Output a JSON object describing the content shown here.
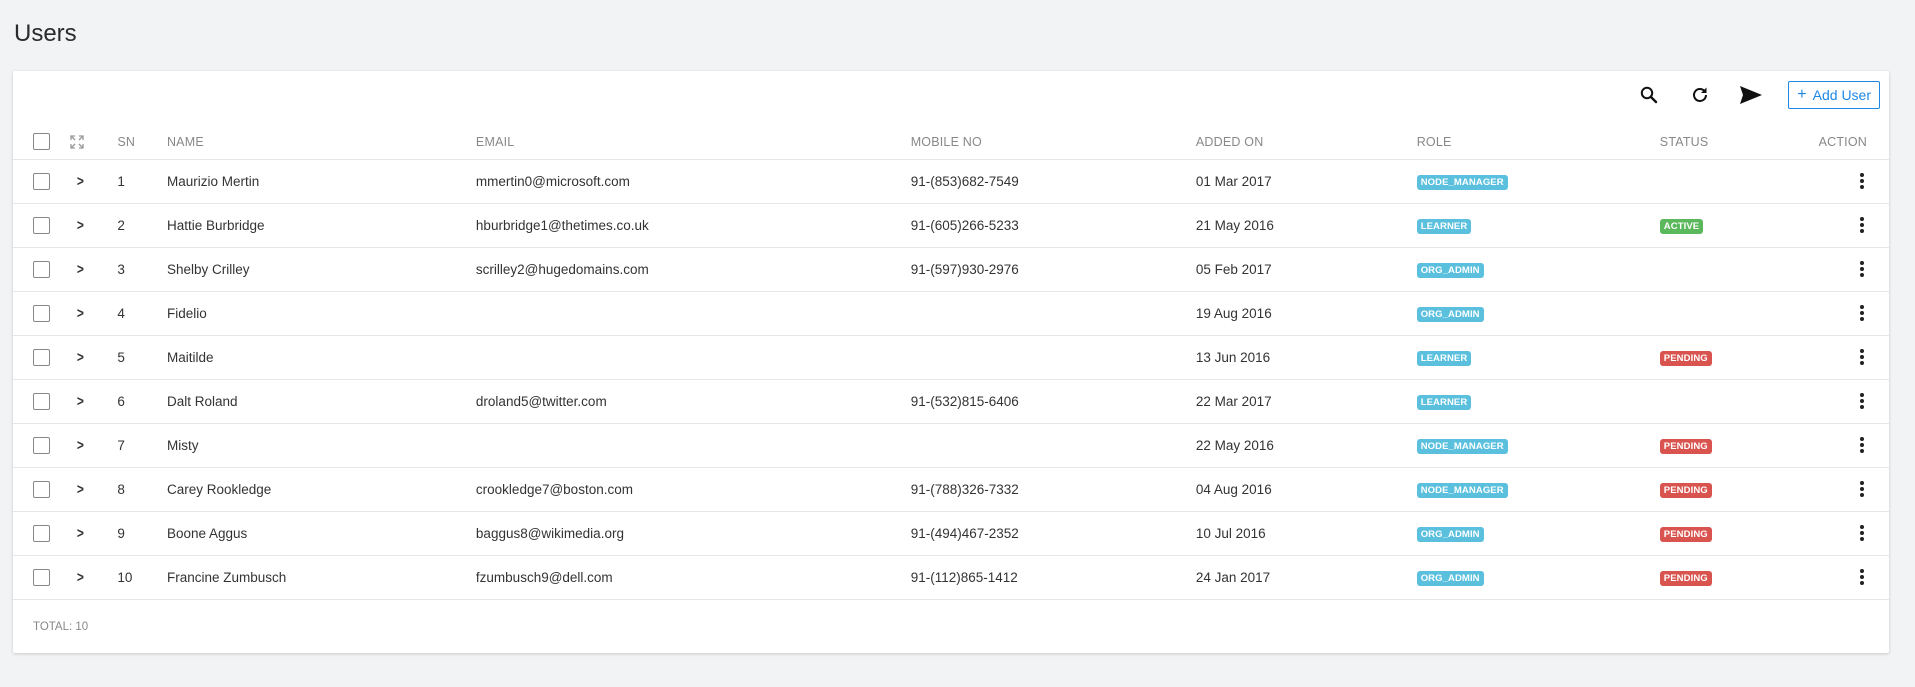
{
  "page": {
    "title": "Users"
  },
  "toolbar": {
    "search_icon": "search-icon",
    "refresh_icon": "refresh-icon",
    "send_icon": "send-icon",
    "add_user_label": "Add User",
    "add_user_icon": "+"
  },
  "columns": {
    "sn": "SN",
    "name": "NAME",
    "email": "EMAIL",
    "mobile": "MOBILE NO",
    "added_on": "ADDED ON",
    "role": "ROLE",
    "status": "STATUS",
    "action": "ACTION"
  },
  "colors": {
    "role_badge": "#5bc0de",
    "active_badge": "#5cb85c",
    "pending_badge": "#d9534f",
    "accent": "#1e88e5"
  },
  "rows": [
    {
      "sn": "1",
      "name": "Maurizio Mertin",
      "email": "mmertin0@microsoft.com",
      "mobile": "91-(853)682-7549",
      "added_on": "01 Mar 2017",
      "role": "NODE_MANAGER",
      "status": ""
    },
    {
      "sn": "2",
      "name": "Hattie Burbridge",
      "email": "hburbridge1@thetimes.co.uk",
      "mobile": "91-(605)266-5233",
      "added_on": "21 May 2016",
      "role": "LEARNER",
      "status": "ACTIVE"
    },
    {
      "sn": "3",
      "name": "Shelby Crilley",
      "email": "scrilley2@hugedomains.com",
      "mobile": "91-(597)930-2976",
      "added_on": "05 Feb 2017",
      "role": "ORG_ADMIN",
      "status": ""
    },
    {
      "sn": "4",
      "name": "Fidelio",
      "email": "",
      "mobile": "",
      "added_on": "19 Aug 2016",
      "role": "ORG_ADMIN",
      "status": ""
    },
    {
      "sn": "5",
      "name": "Maitilde",
      "email": "",
      "mobile": "",
      "added_on": "13 Jun 2016",
      "role": "LEARNER",
      "status": "PENDING"
    },
    {
      "sn": "6",
      "name": "Dalt Roland",
      "email": "droland5@twitter.com",
      "mobile": "91-(532)815-6406",
      "added_on": "22 Mar 2017",
      "role": "LEARNER",
      "status": ""
    },
    {
      "sn": "7",
      "name": "Misty",
      "email": "",
      "mobile": "",
      "added_on": "22 May 2016",
      "role": "NODE_MANAGER",
      "status": "PENDING"
    },
    {
      "sn": "8",
      "name": "Carey Rookledge",
      "email": "crookledge7@boston.com",
      "mobile": "91-(788)326-7332",
      "added_on": "04 Aug 2016",
      "role": "NODE_MANAGER",
      "status": "PENDING"
    },
    {
      "sn": "9",
      "name": "Boone Aggus",
      "email": "baggus8@wikimedia.org",
      "mobile": "91-(494)467-2352",
      "added_on": "10 Jul 2016",
      "role": "ORG_ADMIN",
      "status": "PENDING"
    },
    {
      "sn": "10",
      "name": "Francine Zumbusch",
      "email": "fzumbusch9@dell.com",
      "mobile": "91-(112)865-1412",
      "added_on": "24 Jan 2017",
      "role": "ORG_ADMIN",
      "status": "PENDING"
    }
  ],
  "footer": {
    "total": "TOTAL: 10"
  }
}
